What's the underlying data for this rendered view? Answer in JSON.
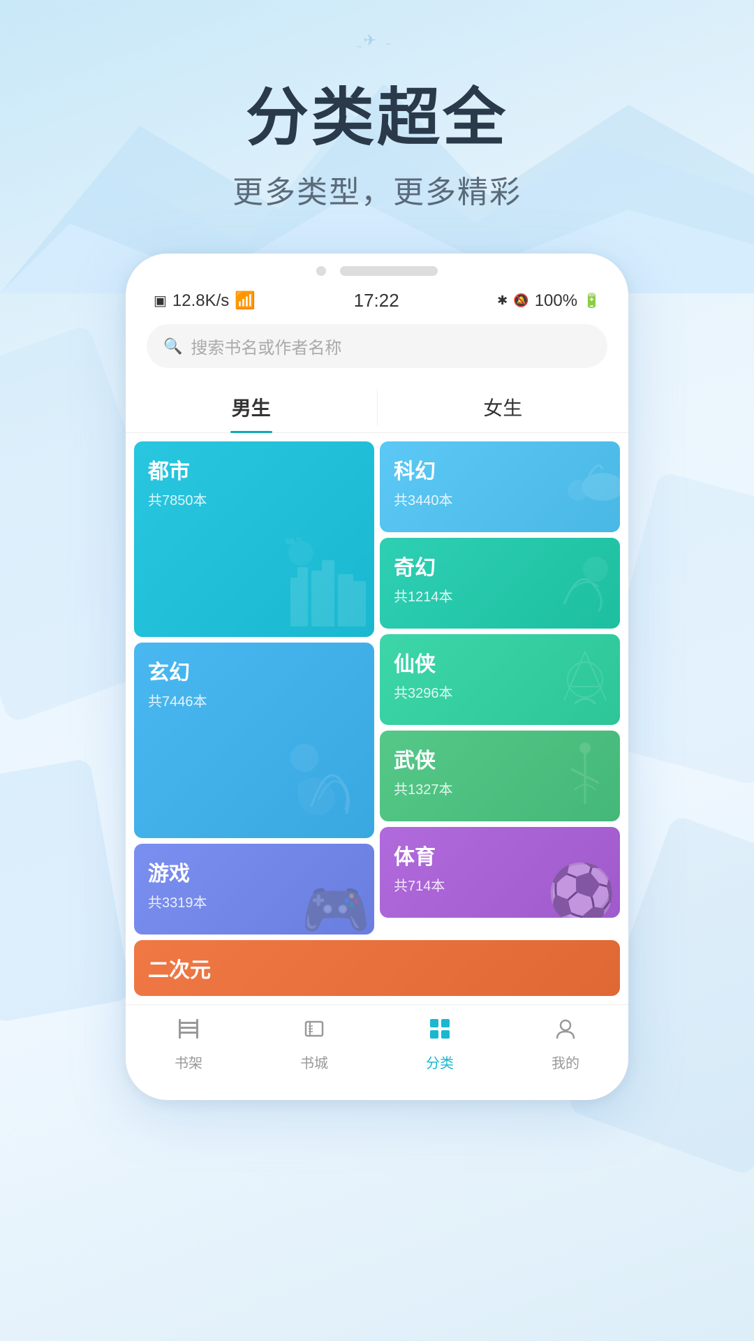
{
  "hero": {
    "title": "分类超全",
    "subtitle": "更多类型，更多精彩"
  },
  "status_bar": {
    "left": "12.8K/s",
    "time": "17:22",
    "battery": "100%"
  },
  "search": {
    "placeholder": "搜索书名或作者名称"
  },
  "tabs": [
    {
      "label": "男生",
      "active": true
    },
    {
      "label": "女生",
      "active": false
    }
  ],
  "categories_left": [
    {
      "name": "都市",
      "count": "共7850本",
      "color": "bg-cyan",
      "size": "card-tall",
      "icon": "🏙"
    },
    {
      "name": "玄幻",
      "count": "共7446本",
      "color": "bg-blue-light",
      "size": "card-tall",
      "icon": "🌙"
    },
    {
      "name": "游戏",
      "count": "共3319本",
      "color": "bg-purple-blue",
      "size": "card-normal",
      "icon": "🎮"
    }
  ],
  "categories_right": [
    {
      "name": "科幻",
      "count": "共3440本",
      "color": "bg-blue-mid",
      "size": "card-normal",
      "icon": "🚀"
    },
    {
      "name": "奇幻",
      "count": "共1214本",
      "color": "bg-teal",
      "size": "card-normal",
      "icon": "🐉"
    },
    {
      "name": "仙侠",
      "count": "共3296本",
      "color": "bg-green-teal",
      "size": "card-normal",
      "icon": "⚔"
    },
    {
      "name": "武侠",
      "count": "共1327本",
      "color": "bg-green",
      "size": "card-normal",
      "icon": "🥷"
    },
    {
      "name": "体育",
      "count": "共714本",
      "color": "bg-purple",
      "size": "card-normal",
      "icon": "⚽"
    }
  ],
  "category_partial": {
    "name": "二次元",
    "color": "bg-orange"
  },
  "bottom_nav": [
    {
      "label": "书架",
      "icon": "📋",
      "active": false
    },
    {
      "label": "书城",
      "icon": "📖",
      "active": false
    },
    {
      "label": "分类",
      "icon": "📚",
      "active": true
    },
    {
      "label": "我的",
      "icon": "👤",
      "active": false
    }
  ]
}
